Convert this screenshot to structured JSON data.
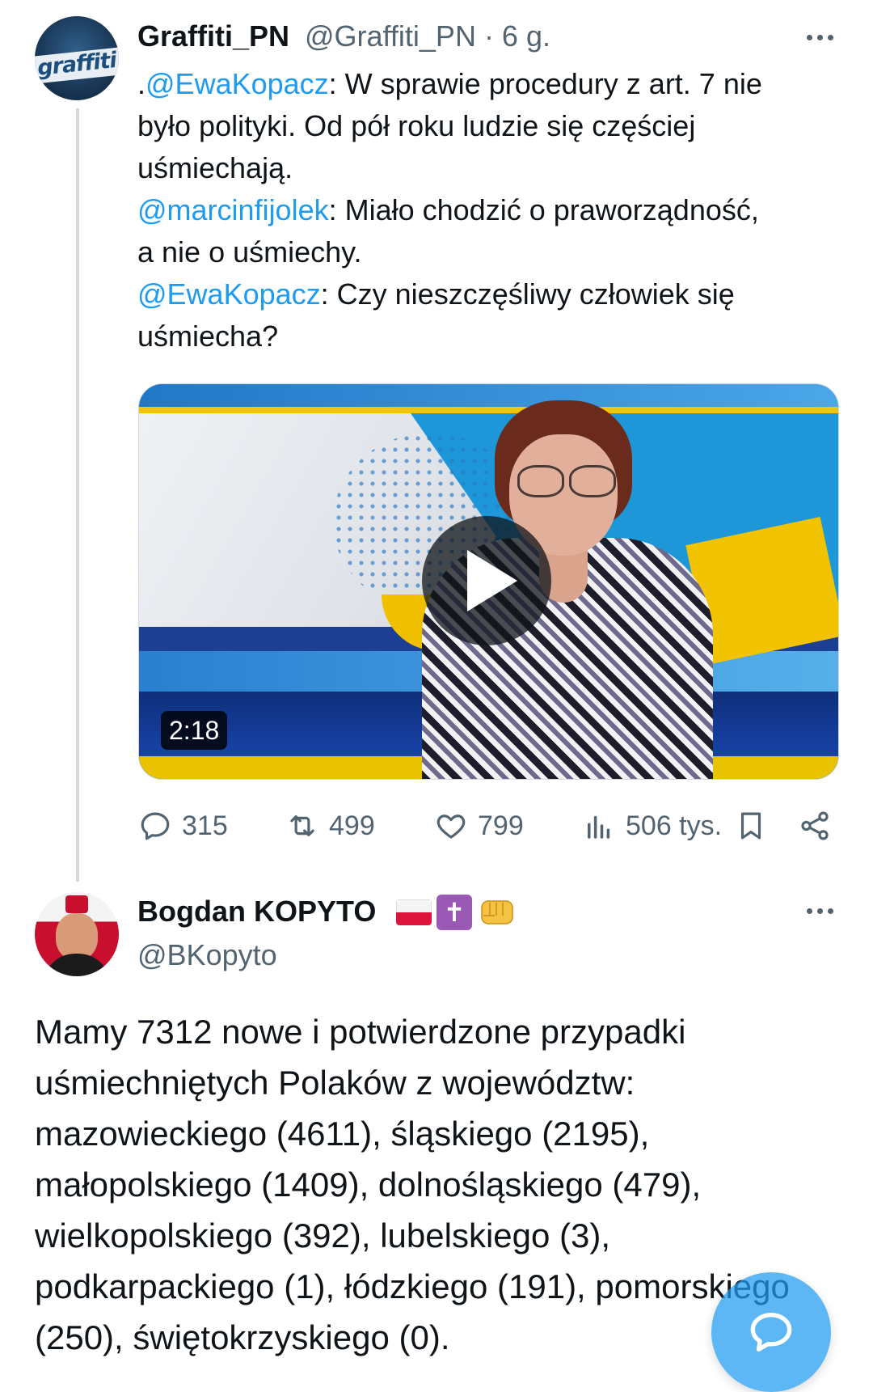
{
  "tweet1": {
    "display_name": "Graffiti_PN",
    "handle_time": "@Graffiti_PN · 6 g.",
    "avatar_text": "graffiti",
    "lines": [
      {
        "prefix": ".",
        "mention": "@EwaKopacz",
        "text": ": W sprawie procedury z art. 7 nie"
      },
      {
        "prefix": "",
        "mention": "",
        "text": "było polityki. Od pół roku ludzie się częściej"
      },
      {
        "prefix": "",
        "mention": "",
        "text": "uśmiechają."
      },
      {
        "prefix": "",
        "mention": "@marcinfijolek",
        "text": ": Miało chodzić o praworządność,"
      },
      {
        "prefix": "",
        "mention": "",
        "text": "a nie o uśmiechy."
      },
      {
        "prefix": "",
        "mention": "@EwaKopacz",
        "text": ": Czy nieszczęśliwy człowiek się"
      },
      {
        "prefix": "",
        "mention": "",
        "text": "uśmiecha?"
      }
    ],
    "video": {
      "duration": "2:18"
    },
    "actions": {
      "replies": "315",
      "reposts": "499",
      "likes": "799",
      "views": "506 tys."
    }
  },
  "tweet2": {
    "display_name": "Bogdan KOPYTO",
    "handle": "@BKopyto",
    "lines": [
      "Mamy 7312 nowe i potwierdzone przypadki",
      "uśmiechniętych Polaków z województw:",
      "mazowieckiego (4611), śląskiego (2195),",
      "małopolskiego (1409), dolnośląskiego (479),",
      "wielkopolskiego (392), lubelskiego (3),",
      "podkarpackiego (1), łódzkiego (191), pomorskiego",
      "(250), świętokrzyskiego (0)."
    ]
  },
  "colors": {
    "accent": "#1d9bf0",
    "secondary_text": "#536471",
    "primary_text": "#0f1419"
  }
}
